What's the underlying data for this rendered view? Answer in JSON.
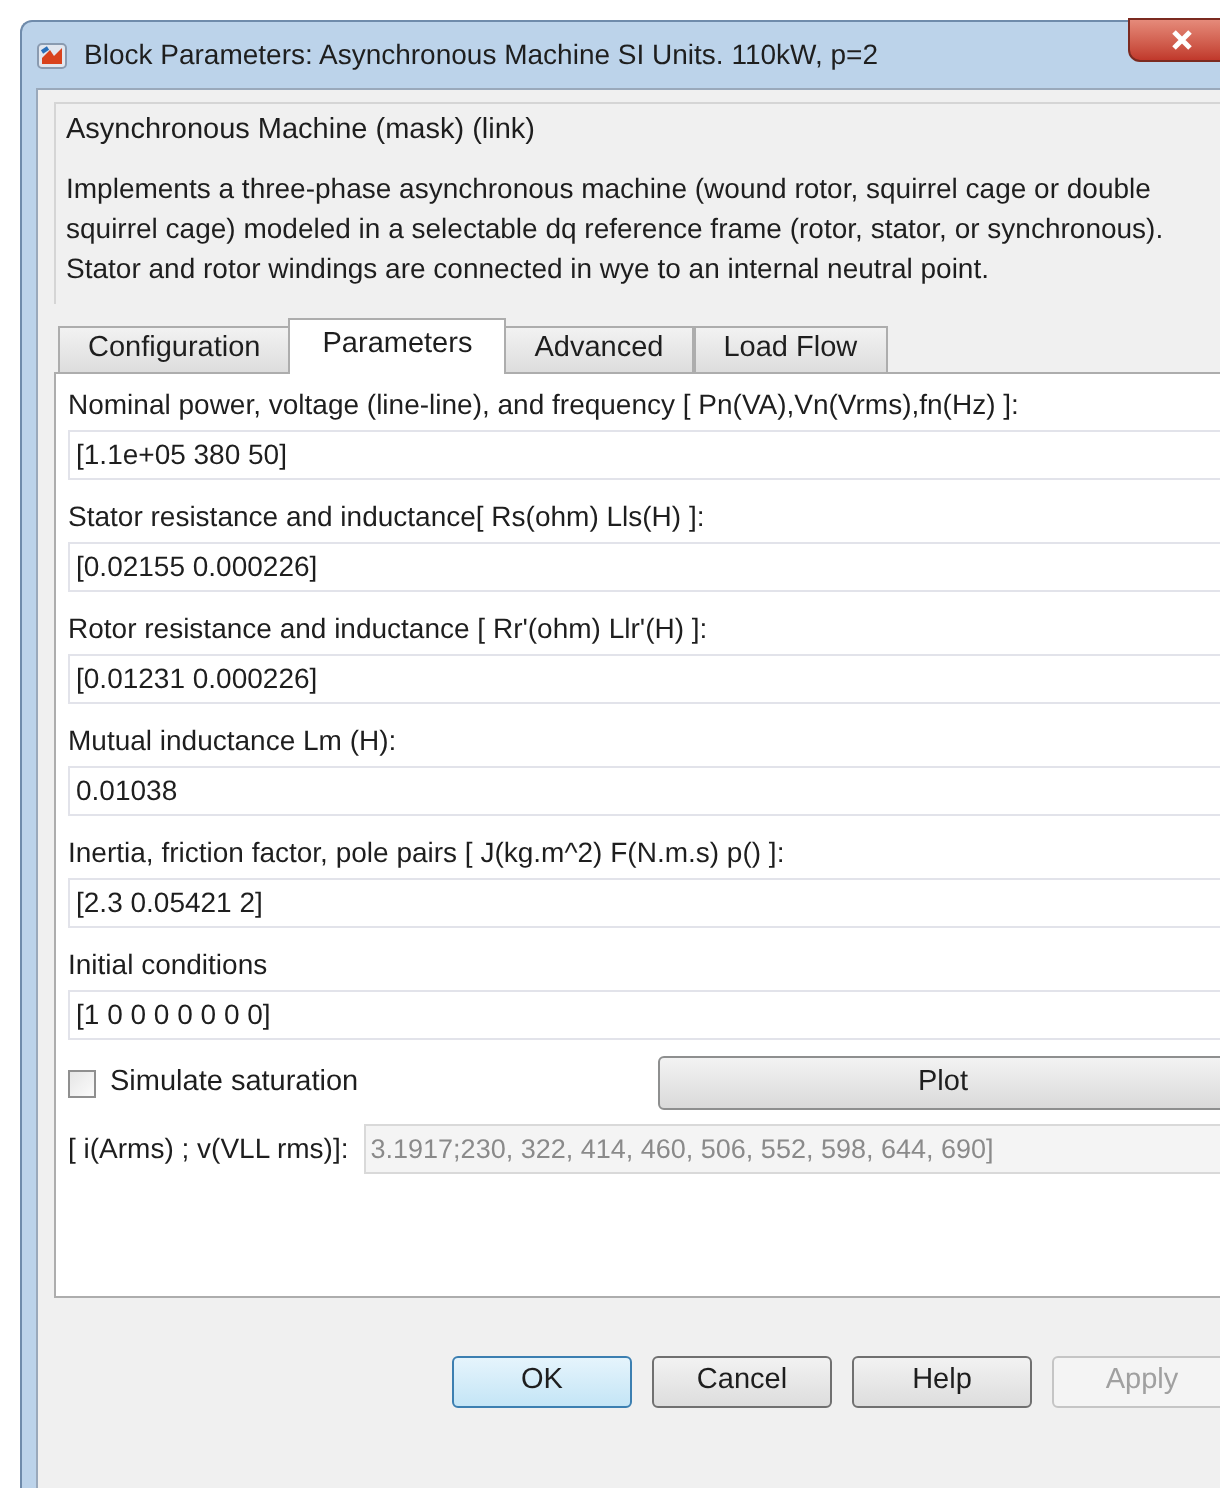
{
  "window": {
    "title": "Block Parameters: Asynchronous Machine SI Units. 110kW, p=2"
  },
  "group": {
    "title": "Asynchronous Machine (mask) (link)",
    "description": "Implements a three-phase asynchronous machine (wound rotor, squirrel cage or double squirrel cage) modeled in a selectable dq reference frame (rotor, stator, or synchronous). Stator and rotor windings are connected in wye to an internal neutral point."
  },
  "tabs": [
    {
      "label": "Configuration",
      "selected": false
    },
    {
      "label": "Parameters",
      "selected": true
    },
    {
      "label": "Advanced",
      "selected": false
    },
    {
      "label": "Load Flow",
      "selected": false
    }
  ],
  "parameters": [
    {
      "label": "Nominal power, voltage (line-line), and frequency [ Pn(VA),Vn(Vrms),fn(Hz) ]:",
      "value": "[1.1e+05 380 50]"
    },
    {
      "label": "Stator resistance and inductance[ Rs(ohm)  Lls(H) ]:",
      "value": "[0.02155 0.000226]"
    },
    {
      "label": "Rotor resistance and inductance [ Rr'(ohm)  Llr'(H) ]:",
      "value": "[0.01231 0.000226]"
    },
    {
      "label": "Mutual inductance Lm (H):",
      "value": "0.01038"
    },
    {
      "label": "Inertia, friction factor, pole pairs [ J(kg.m^2)  F(N.m.s)   p() ]:",
      "value": "[2.3 0.05421 2]"
    },
    {
      "label": "Initial conditions",
      "value": "[1 0 0 0 0 0 0 0]"
    }
  ],
  "saturation": {
    "label": "Simulate saturation",
    "checked": false,
    "plot_button": "Plot"
  },
  "saturation_data": {
    "label": "[ i(Arms) ; v(VLL rms)]:",
    "value": "3.1917;230, 322, 414, 460, 506, 552, 598, 644, 690]",
    "disabled": true
  },
  "buttons": [
    {
      "label": "OK",
      "default": true,
      "disabled": false
    },
    {
      "label": "Cancel",
      "default": false,
      "disabled": false
    },
    {
      "label": "Help",
      "default": false,
      "disabled": false
    },
    {
      "label": "Apply",
      "default": false,
      "disabled": true
    }
  ]
}
